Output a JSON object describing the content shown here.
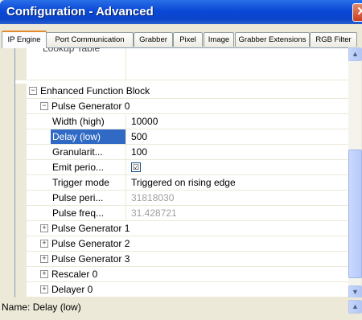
{
  "window": {
    "title": "Configuration - Advanced",
    "close_glyph": "✕"
  },
  "tabs": [
    {
      "label": "IP Engine",
      "active": true
    },
    {
      "label": "Port Communication"
    },
    {
      "label": "Grabber"
    },
    {
      "label": "Pixel"
    },
    {
      "label": "Image"
    },
    {
      "label": "Grabber Extensions"
    },
    {
      "label": "RGB Filter"
    }
  ],
  "grid": {
    "top_partial_label": "Lookup Table",
    "category": "Enhanced Function Block",
    "group": "Pulse Generator 0",
    "properties": [
      {
        "name": "Width (high)",
        "value": "10000"
      },
      {
        "name": "Delay (low)",
        "value": "500",
        "selected": true
      },
      {
        "name": "Granularit...",
        "value": "100"
      },
      {
        "name": "Emit perio...",
        "value": "☑"
      },
      {
        "name": "Trigger mode",
        "value": "Triggered on rising edge"
      },
      {
        "name": "Pulse peri...",
        "value": "31818030",
        "disabled": true
      },
      {
        "name": "Pulse freq...",
        "value": "31.428721",
        "disabled": true
      }
    ],
    "collapsed_groups": [
      "Pulse Generator 1",
      "Pulse Generator 2",
      "Pulse Generator 3",
      "Rescaler 0",
      "Delayer 0"
    ],
    "expand_glyph": "+",
    "collapse_glyph": "−"
  },
  "help": {
    "name_label": "Name",
    "name_value": "Delay (low)"
  },
  "scrollbar": {
    "up_glyph": "▲",
    "down_glyph": "▼"
  },
  "icons": {
    "close": "close-icon",
    "expand": "plus-icon",
    "collapse": "minus-icon",
    "check": "checkbox-icon"
  }
}
